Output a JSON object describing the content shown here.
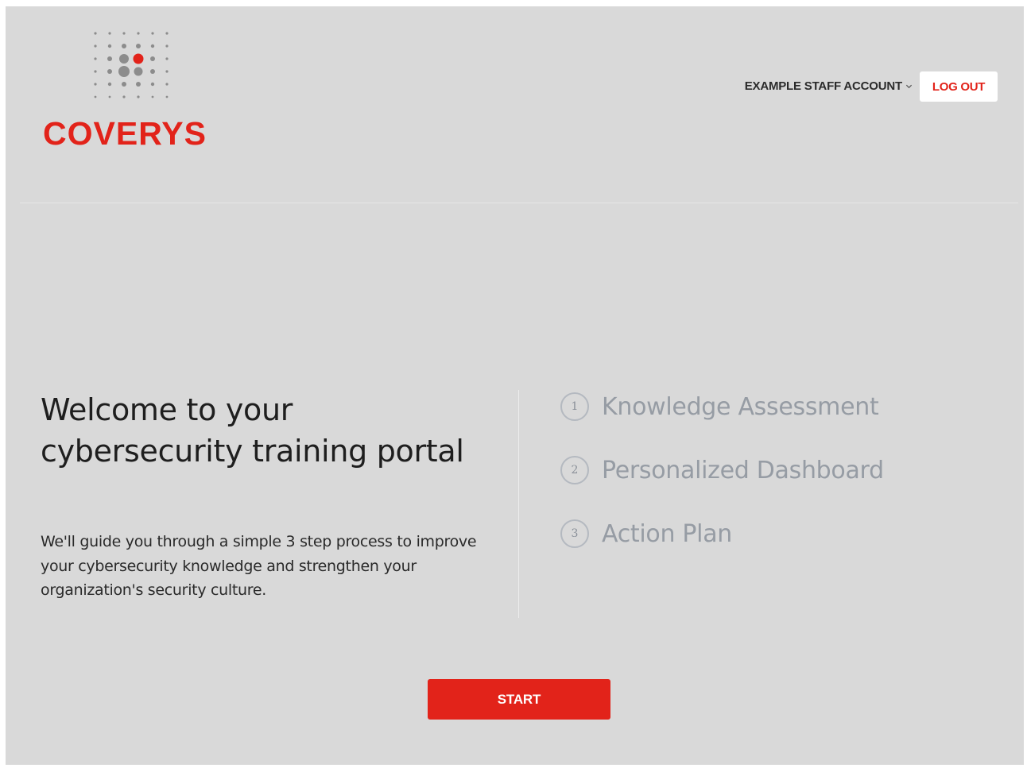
{
  "header": {
    "brand_name": "COVERYS",
    "account_label": "EXAMPLE STAFF ACCOUNT",
    "logout_label": "LOG OUT"
  },
  "welcome": {
    "title": "Welcome to your cybersecurity training portal",
    "body": "We'll guide you through a simple 3 step process to improve your cybersecurity knowledge and strengthen your organization's security culture."
  },
  "steps": [
    {
      "number": "1",
      "label": "Knowledge Assessment"
    },
    {
      "number": "2",
      "label": "Personalized Dashboard"
    },
    {
      "number": "3",
      "label": "Action Plan"
    }
  ],
  "actions": {
    "start_label": "START"
  },
  "colors": {
    "brand_red": "#e2231a",
    "page_background": "#d9d9d9",
    "step_gray": "#969ca4"
  },
  "icons": {
    "logo_mark": "dot-grid-logo-icon",
    "account_menu": "chevron-down-icon"
  }
}
